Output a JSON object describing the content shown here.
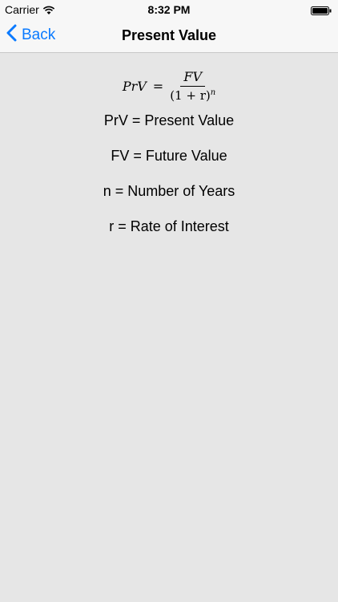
{
  "status_bar": {
    "carrier": "Carrier",
    "time": "8:32 PM"
  },
  "nav": {
    "back_label": "Back",
    "title": "Present Value"
  },
  "formula": {
    "lhs": "PrV",
    "equals": "=",
    "numerator": "FV",
    "denominator_base": "(1 + r)",
    "denominator_exponent": "n"
  },
  "definitions": [
    "PrV = Present Value",
    "FV = Future Value",
    "n = Number of Years",
    "r = Rate of Interest"
  ],
  "colors": {
    "accent": "#0a7aff",
    "background": "#e6e6e6",
    "bar": "#f7f7f7"
  }
}
